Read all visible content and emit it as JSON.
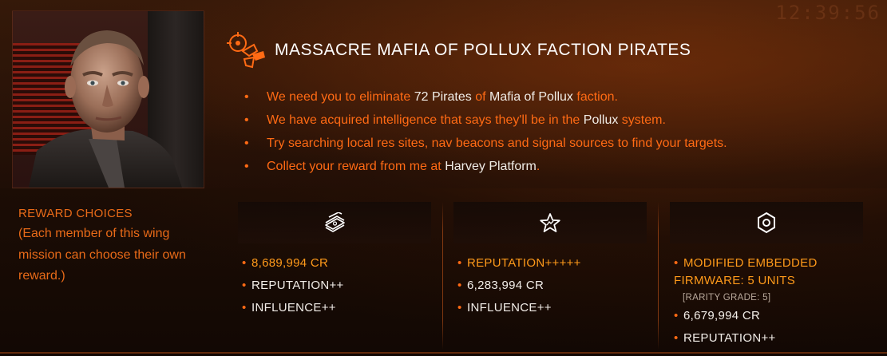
{
  "clock": "12:39:56",
  "mission": {
    "title": "MASSACRE MAFIA OF POLLUX FACTION PIRATES",
    "briefing": [
      {
        "parts": [
          {
            "text": "We need you to eliminate ",
            "hl": false
          },
          {
            "text": "72 Pirates",
            "hl": true
          },
          {
            "text": " of ",
            "hl": false
          },
          {
            "text": "Mafia of Pollux",
            "hl": true
          },
          {
            "text": " faction.",
            "hl": false
          }
        ]
      },
      {
        "parts": [
          {
            "text": "We have acquired intelligence that says they'll be in the ",
            "hl": false
          },
          {
            "text": "Pollux",
            "hl": true
          },
          {
            "text": " system.",
            "hl": false
          }
        ]
      },
      {
        "parts": [
          {
            "text": "Try searching local res sites, nav beacons and signal sources to find your targets.",
            "hl": false
          }
        ]
      },
      {
        "parts": [
          {
            "text": "Collect your reward from me at ",
            "hl": false
          },
          {
            "text": "Harvey Platform",
            "hl": true
          },
          {
            "text": ".",
            "hl": false
          }
        ]
      }
    ]
  },
  "rewards": {
    "heading": "REWARD CHOICES",
    "note": "(Each member of this wing mission can choose their own reward.)",
    "bullet": "•",
    "options": [
      {
        "icon": "credits-icon",
        "items": [
          {
            "text": "8,689,994 CR",
            "style": "top"
          },
          {
            "text": "REPUTATION++",
            "style": "normal"
          },
          {
            "text": "INFLUENCE++",
            "style": "normal"
          }
        ]
      },
      {
        "icon": "reputation-star-icon",
        "items": [
          {
            "text": "REPUTATION+++++",
            "style": "top"
          },
          {
            "text": "6,283,994 CR",
            "style": "normal"
          },
          {
            "text": "INFLUENCE++",
            "style": "normal"
          }
        ]
      },
      {
        "icon": "material-hexagon-icon",
        "items": [
          {
            "text": "MODIFIED EMBEDDED FIRMWARE: 5 UNITS",
            "style": "top wrap"
          },
          {
            "text": "[RARITY GRADE: 5]",
            "style": "sub"
          },
          {
            "text": "6,679,994 CR",
            "style": "normal"
          },
          {
            "text": "REPUTATION++",
            "style": "normal"
          }
        ]
      }
    ]
  },
  "colors": {
    "accent": "#ff6a14",
    "highlight": "#f0ece6",
    "reward_primary": "#ff9a1a"
  }
}
